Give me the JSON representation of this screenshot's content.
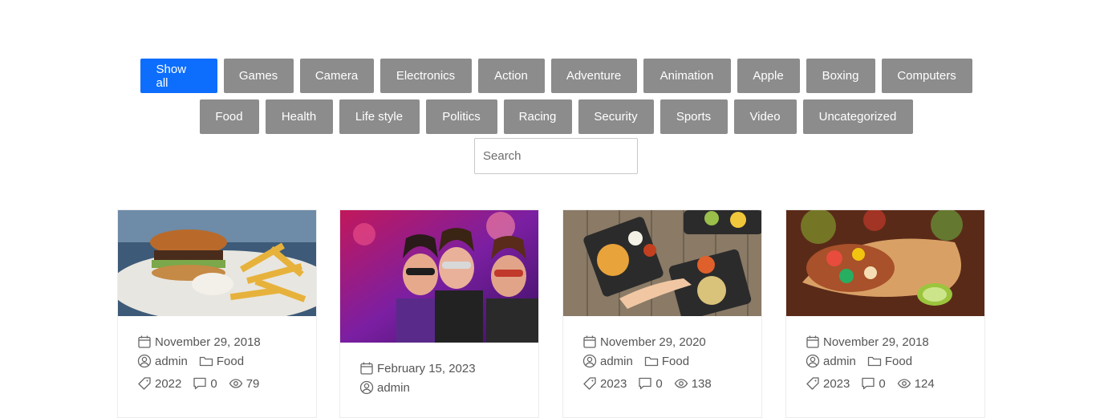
{
  "filters": {
    "row1": [
      "Show all",
      "Games",
      "Camera",
      "Electronics",
      "Action",
      "Adventure",
      "Animation",
      "Apple",
      "Boxing",
      "Computers"
    ],
    "row2": [
      "Food",
      "Health",
      "Life style",
      "Politics",
      "Racing",
      "Security",
      "Sports",
      "Video",
      "Uncategorized"
    ],
    "active": "Show all"
  },
  "search": {
    "placeholder": "Search",
    "value": ""
  },
  "colors": {
    "active": "#0d6efd",
    "inactive": "#8c8c8c"
  },
  "posts": [
    {
      "image": "burger-and-fries-photo",
      "date": "November 29, 2018",
      "author": "admin",
      "category": "Food",
      "tag": "2022",
      "comments": "0",
      "views": "79"
    },
    {
      "image": "masquerade-party-photo",
      "date": "February 15, 2023",
      "author": "admin",
      "category": "",
      "tag": "",
      "comments": "",
      "views": ""
    },
    {
      "image": "food-platters-table-photo",
      "date": "November 29, 2020",
      "author": "admin",
      "category": "Food",
      "tag": "2023",
      "comments": "0",
      "views": "138"
    },
    {
      "image": "burrito-wrap-photo",
      "date": "November 29, 2018",
      "author": "admin",
      "category": "Food",
      "tag": "2023",
      "comments": "0",
      "views": "124"
    }
  ]
}
